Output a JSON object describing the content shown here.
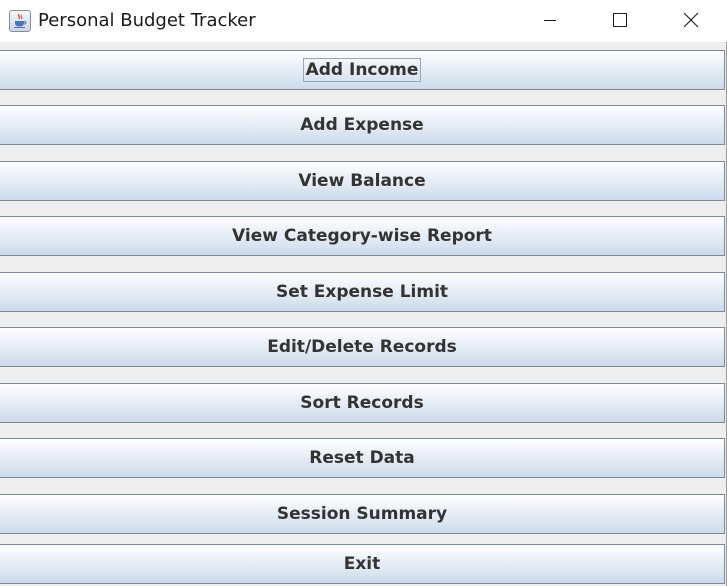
{
  "window": {
    "title": "Personal Budget Tracker",
    "app_icon": "java-coffee-cup-icon",
    "controls": {
      "minimize_icon": "minimize-icon",
      "maximize_icon": "maximize-icon",
      "close_icon": "close-icon"
    }
  },
  "menu": {
    "focused_index": 0,
    "buttons": [
      {
        "label": "Add Income"
      },
      {
        "label": "Add Expense"
      },
      {
        "label": "View Balance"
      },
      {
        "label": "View Category-wise Report"
      },
      {
        "label": "Set Expense Limit"
      },
      {
        "label": "Edit/Delete Records"
      },
      {
        "label": "Sort Records"
      },
      {
        "label": "Reset Data"
      },
      {
        "label": "Session Summary"
      },
      {
        "label": "Exit"
      }
    ]
  },
  "colors": {
    "window_background": "#eeeeee",
    "button_text": "#333333",
    "button_border": "#7a8a99"
  }
}
